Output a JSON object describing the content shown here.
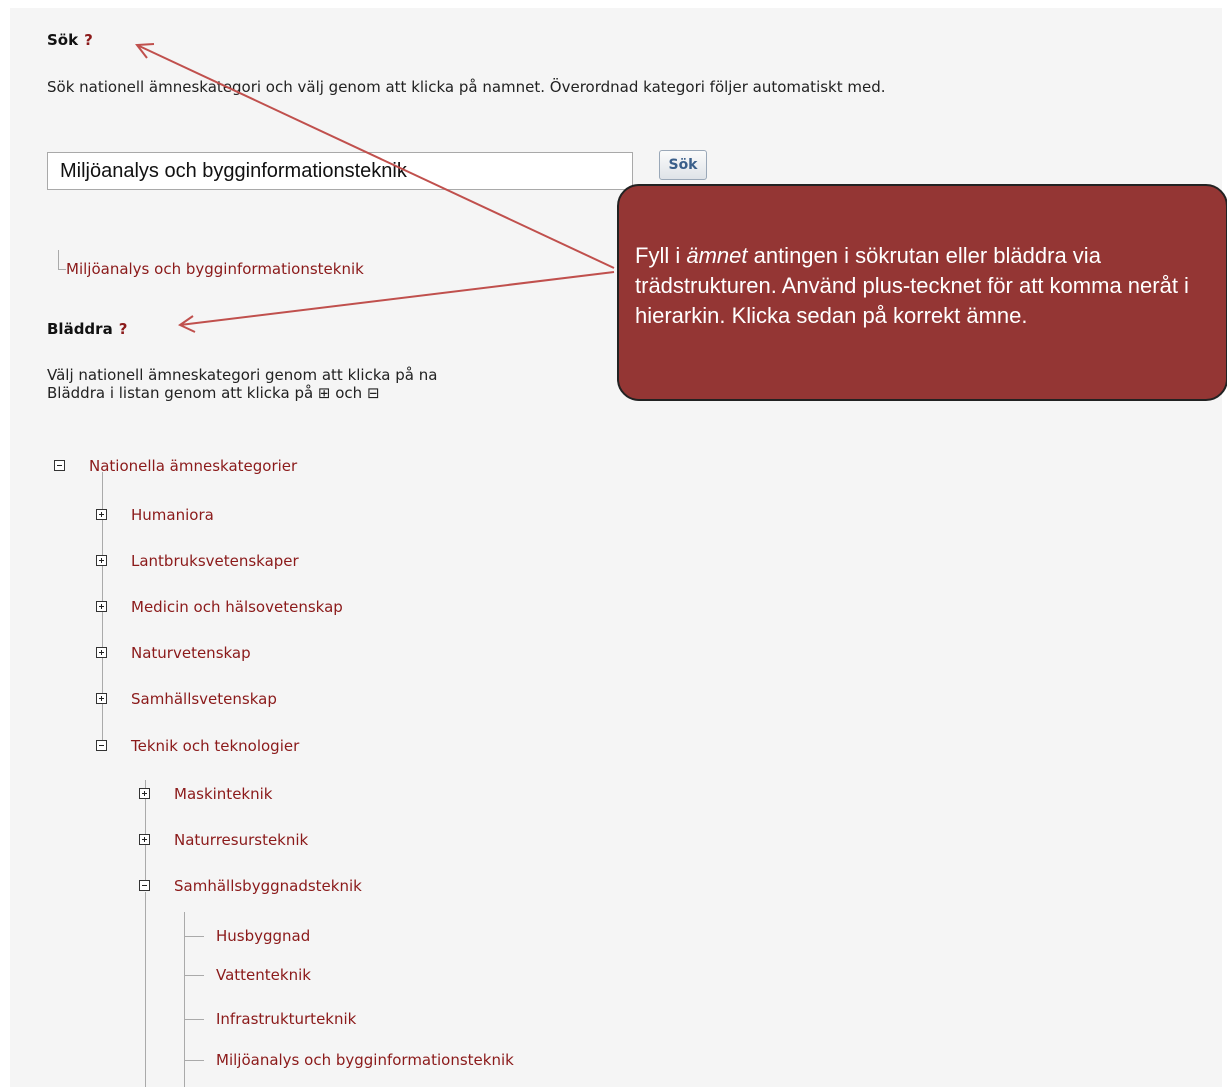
{
  "search": {
    "heading": "Sök",
    "help": "?",
    "description": "Sök nationell ämneskategori och välj genom att klicka på namnet. Överordnad kategori följer automatiskt med.",
    "input_value": "Miljöanalys och bygginformationsteknik",
    "button_label": "Sök",
    "result": "Miljöanalys och bygginformationsteknik"
  },
  "browse": {
    "heading": "Bläddra",
    "help": "?",
    "description_line1": "Välj nationell ämneskategori genom att klicka på na",
    "description_line2": "Bläddra i listan genom att klicka på ⊞ och ⊟"
  },
  "tree": {
    "root": "Nationella ämneskategorier",
    "level1": [
      "Humaniora",
      "Lantbruksvetenskaper",
      "Medicin och hälsovetenskap",
      "Naturvetenskap",
      "Samhällsvetenskap",
      "Teknik och teknologier"
    ],
    "level2": [
      "Maskinteknik",
      "Naturresursteknik",
      "Samhällsbyggnadsteknik"
    ],
    "level3": [
      "Husbyggnad",
      "Vattenteknik",
      "Infrastrukturteknik",
      "Miljöanalys och bygginformationsteknik"
    ]
  },
  "callout": {
    "text_before": "Fyll i ",
    "text_emphasis": "ämnet",
    "text_after": " antingen i sökrutan eller bläddra via trädstrukturen. Använd plus-tecknet för att komma neråt i hierarkin. Klicka sedan på korrekt  ämne.",
    "color": "#943634"
  },
  "colors": {
    "link": "#8b1a1a",
    "background": "#f5f5f5"
  }
}
